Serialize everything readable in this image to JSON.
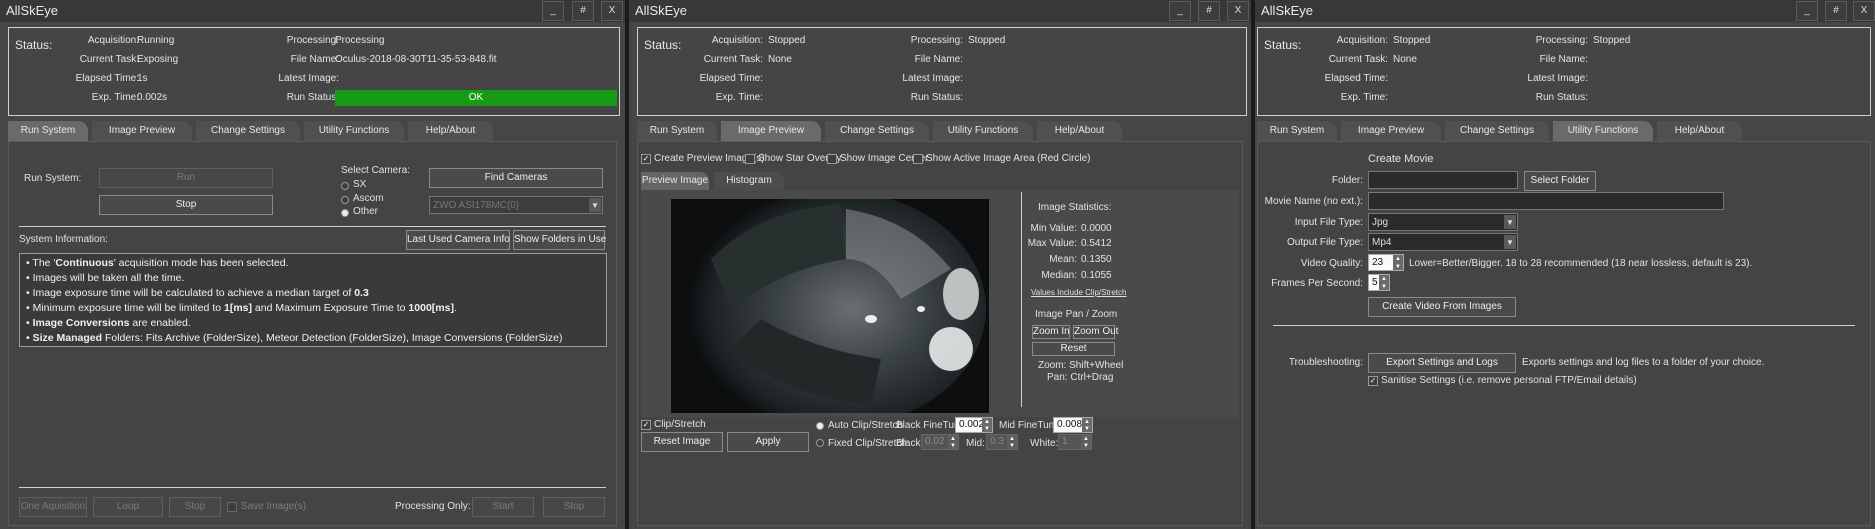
{
  "app_title": "AllSkEye",
  "window_buttons": [
    "_",
    "#",
    "X"
  ],
  "tabs": [
    "Run System",
    "Image Preview",
    "Change Settings",
    "Utility Functions",
    "Help/About"
  ],
  "status_labels": {
    "status": "Status:",
    "acquisition": "Acquisition:",
    "current_task": "Current Task:",
    "elapsed_time": "Elapsed Time:",
    "exp_time": "Exp. Time:",
    "processing": "Processing:",
    "file_name": "File Name:",
    "latest_image": "Latest Image:",
    "run_status": "Run Status:"
  },
  "win1": {
    "status": {
      "acquisition": "Running",
      "current_task": "Exposing",
      "elapsed_time": "1s",
      "exp_time": "0.002s",
      "processing": "Processing",
      "file_name": "Oculus-2018-08-30T11-35-53-848.fit",
      "latest_image": "",
      "run_status": "OK"
    },
    "run_label": "Run System:",
    "run_button": "Run",
    "stop_button": "Stop",
    "select_camera_label": "Select Camera:",
    "camera_options": [
      "SX",
      "Ascom",
      "Other"
    ],
    "camera_selected": "Other",
    "find_cameras_button": "Find Cameras",
    "camera_dropdown": "ZWO ASI178MC(0)",
    "system_info_label": "System Information:",
    "last_camera_button": "Last Used Camera Info",
    "show_folders_button": "Show Folders in Use",
    "info": {
      "l1_pre": "• The '",
      "l1_bold": "Continuous",
      "l1_post": "' acquisition mode has been selected.",
      "l2": "• Images will be taken all the time.",
      "l3_pre": "• Image exposure time will be calculated to achieve a median target of ",
      "l3_bold": "0.3",
      "l4_pre": "• Minimum exposure time will be limited to ",
      "l4_b1": "1[ms]",
      "l4_mid": " and Maximum Exposure Time to ",
      "l4_b2": "1000[ms]",
      "l4_post": ".",
      "l5_pre": "• ",
      "l5_bold": "Image Conversions",
      "l5_post": " are enabled.",
      "l6_pre": "• ",
      "l6_bold": "Size Managed",
      "l6_post": " Folders: Fits Archive (FolderSize), Meteor Detection (FolderSize), Image Conversions (FolderSize)"
    },
    "bottom": {
      "one_acq": "One Aquisition",
      "loop": "Loop",
      "stop": "Stop",
      "save_images": "Save Image(s)",
      "processing_only": "Processing Only:",
      "start": "Start",
      "stop2": "Stop"
    }
  },
  "win2": {
    "status": {
      "acquisition": "Stopped",
      "current_task": "None",
      "elapsed_time": "",
      "exp_time": "",
      "processing": "Stopped",
      "file_name": "",
      "latest_image": "",
      "run_status": ""
    },
    "checks": {
      "create_preview": "Create Preview Image(s)",
      "star_overlay": "Show Star Overlay",
      "image_center": "Show Image Center",
      "active_area": "Show Active Image Area (Red Circle)"
    },
    "subtabs": [
      "Preview Image",
      "Histogram"
    ],
    "stats": {
      "title": "Image Statistics:",
      "min_label": "Min Value:",
      "min": "0.0000",
      "max_label": "Max Value:",
      "max": "0.5412",
      "mean_label": "Mean:",
      "mean": "0.1350",
      "median_label": "Median:",
      "median": "0.1055",
      "note": "Values Include Clip/Stretch"
    },
    "panzoom": {
      "title": "Image Pan / Zoom",
      "zoom_in": "Zoom In",
      "zoom_out": "Zoom Out",
      "reset": "Reset",
      "hint1": "Zoom: Shift+Wheel",
      "hint2": "Pan: Ctrl+Drag"
    },
    "bottom": {
      "clip_stretch": "Clip/Stretch",
      "reset_image": "Reset Image",
      "apply": "Apply",
      "auto_clip": "Auto Clip/Stretch",
      "black_finetune": "Black FineTune:",
      "black_finetune_val": "0.002",
      "mid_finetune": "Mid FineTune:",
      "mid_finetune_val": "0.008",
      "fixed_clip": "Fixed Clip/Stretch",
      "black": "Black:",
      "black_val": "0.02",
      "mid": "Mid:",
      "mid_val": "0.3",
      "white": "White:",
      "white_val": "1"
    }
  },
  "win3": {
    "status": {
      "acquisition": "Stopped",
      "current_task": "None",
      "elapsed_time": "",
      "exp_time": "",
      "processing": "Stopped",
      "file_name": "",
      "latest_image": "",
      "run_status": ""
    },
    "create_movie": "Create Movie",
    "folder_label": "Folder:",
    "folder_val": "",
    "select_folder": "Select Folder",
    "movie_name_label": "Movie Name (no ext.):",
    "movie_name_val": "",
    "input_type_label": "Input File Type:",
    "input_type_val": "Jpg",
    "output_type_label": "Output File Type:",
    "output_type_val": "Mp4",
    "video_quality_label": "Video Quality:",
    "video_quality_val": "23",
    "video_quality_hint": "Lower=Better/Bigger. 18 to 28 recommended (18 near lossless, default is 23).",
    "fps_label": "Frames Per Second:",
    "fps_val": "5",
    "create_video": "Create Video From Images",
    "troubleshooting_label": "Troubleshooting:",
    "export_button": "Export Settings and Logs",
    "export_hint": "Exports settings and log files to a folder of your choice.",
    "sanitise": "Sanitise Settings (i.e. remove personal FTP/Email details)"
  }
}
